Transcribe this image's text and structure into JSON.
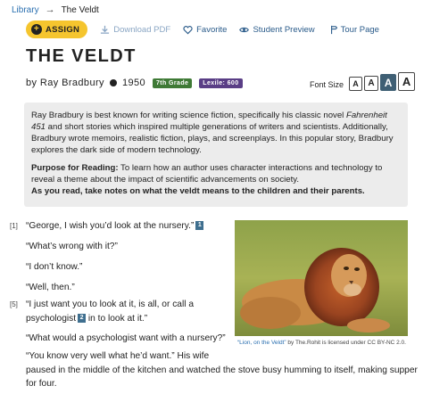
{
  "breadcrumb": {
    "library": "Library",
    "separator": "→",
    "current": "The Veldt"
  },
  "toolbar": {
    "assign": "ASSIGN",
    "download": "Download PDF",
    "favorite": "Favorite",
    "preview": "Student Preview",
    "tour": "Tour Page"
  },
  "title": "THE VELDT",
  "byline": {
    "author": "by Ray Bradbury",
    "year": "1950",
    "grade": "7th Grade",
    "lexile": "Lexile: 600"
  },
  "font_size": {
    "label": "Font Size",
    "options": [
      "A",
      "A",
      "A",
      "A"
    ],
    "selected_index": 2
  },
  "intro": {
    "p1_a": "Ray Bradbury is best known for writing science fiction, specifically his classic novel ",
    "p1_italic": "Fahrenheit 451",
    "p1_b": " and short stories which inspired multiple generations of writers and scientists. Additionally, Bradbury wrote memoirs, realistic fiction, plays, and screenplays. In this popular story, Bradbury explores the dark side of modern technology.",
    "purpose_label": "Purpose for Reading:",
    "purpose_text": " To learn how an author uses character interactions and technology to reveal a theme about the impact of scientific advancements on society.",
    "instruction": "As you read, take notes on what the veldt means to the children and their parents."
  },
  "text": {
    "para1_num": "[1]",
    "para5_num": "[5]",
    "l1": "“George, I wish you’d look at the nursery.”",
    "fn1": "1",
    "l2": "“What’s wrong with it?”",
    "l3": "“I don’t know.”",
    "l4": "“Well, then.”",
    "l5a": "“I just want you to look at it, is all, or call a",
    "l5b_pre": "psychologist",
    "fn2": "2",
    "l5b_post": " in to look at it.”",
    "l6": "“What would a psychologist want with a nursery?”",
    "l7a": "“You know very well what he’d want.” His wife",
    "l7b": "paused in the middle of the kitchen and watched the stove busy humming to itself, making supper",
    "l7c": "for four."
  },
  "image": {
    "caption_link": "“Lion, on the Veldt”",
    "caption_text": " by The.Rohit is licensed under CC BY-NC 2.0."
  },
  "colors": {
    "assign_bg": "#f5c52e",
    "link": "#2a6fb0",
    "grade_badge": "#3f7a36",
    "lexile_badge": "#5a3e86",
    "footnote": "#3f6f8f"
  }
}
